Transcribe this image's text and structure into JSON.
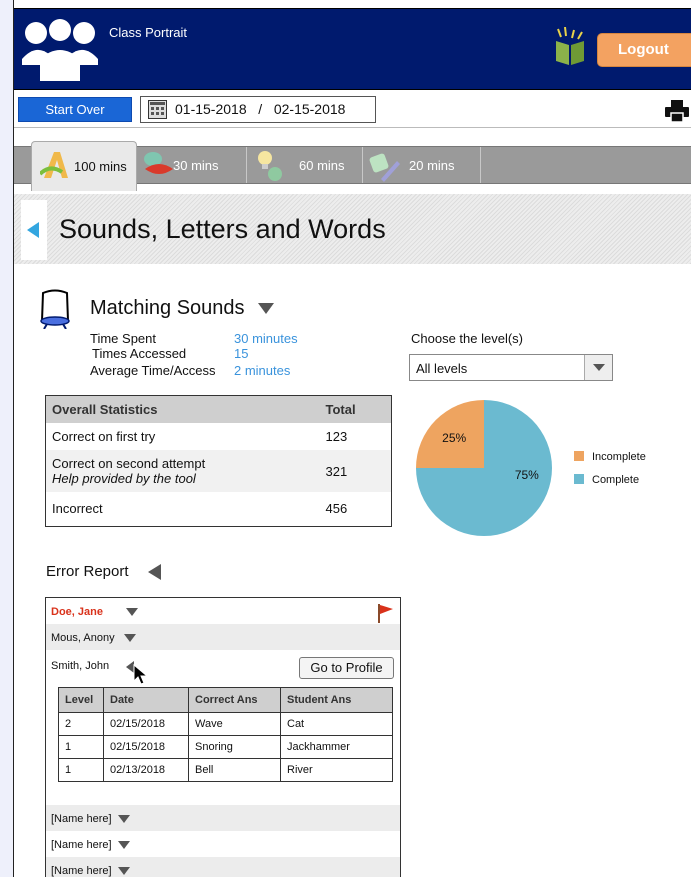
{
  "header": {
    "app_title": "Class Portrait",
    "logout_label": "Logout",
    "colors": {
      "header_bg": "#001a6e",
      "logout_bg": "#f3a261"
    }
  },
  "toolbar": {
    "start_over_label": "Start Over",
    "date_range": "01-15-2018   /   02-15-2018"
  },
  "tabs": [
    {
      "label": "100 mins",
      "icon": "letter-a-icon",
      "active": true
    },
    {
      "label": "30 mins",
      "icon": "lips-icon",
      "active": false
    },
    {
      "label": "60 mins",
      "icon": "lightbulb-icon",
      "active": false
    },
    {
      "label": "20 mins",
      "icon": "pencil-icon",
      "active": false
    }
  ],
  "section": {
    "title": "Sounds, Letters and Words"
  },
  "activity": {
    "title": "Matching Sounds",
    "stats": [
      {
        "label": "Time Spent",
        "value": "30 minutes"
      },
      {
        "label": "Times Accessed",
        "value": "15"
      },
      {
        "label": "Average Time/Access",
        "value": "2 minutes"
      }
    ],
    "level_label": "Choose the level(s)",
    "level_selected": "All levels"
  },
  "overall_table": {
    "headers": [
      "Overall Statistics",
      "Total"
    ],
    "rows": [
      {
        "label": "Correct on first try",
        "note": "",
        "total": "123"
      },
      {
        "label": "Correct on second attempt",
        "note": "Help provided by the tool",
        "total": "321"
      },
      {
        "label": "Incorrect",
        "note": "",
        "total": "456"
      }
    ]
  },
  "chart_data": {
    "type": "pie",
    "slices": [
      {
        "label": "Incomplete",
        "value": 25,
        "display": "25%",
        "color": "#eea460"
      },
      {
        "label": "Complete",
        "value": 75,
        "display": "75%",
        "color": "#6bbad0"
      }
    ],
    "legend_position": "right"
  },
  "error_report": {
    "title": "Error Report",
    "students": [
      {
        "name": "Doe, Jane",
        "flagged": true
      },
      {
        "name": "Mous, Anony",
        "flagged": false
      },
      {
        "name": "Smith, John",
        "flagged": false
      }
    ],
    "go_to_profile_label": "Go to Profile",
    "detail_headers": [
      "Level",
      "Date",
      "Correct Ans",
      "Student Ans"
    ],
    "detail_rows": [
      [
        "2",
        "02/15/2018",
        "Wave",
        "Cat"
      ],
      [
        "1",
        "02/15/2018",
        "Snoring",
        "Jackhammer"
      ],
      [
        "1",
        "02/13/2018",
        "Bell",
        "River"
      ]
    ],
    "placeholders": [
      "[Name here]",
      "[Name here]",
      "[Name here]"
    ],
    "colors": {
      "flagged_name": "#d9321b"
    }
  }
}
